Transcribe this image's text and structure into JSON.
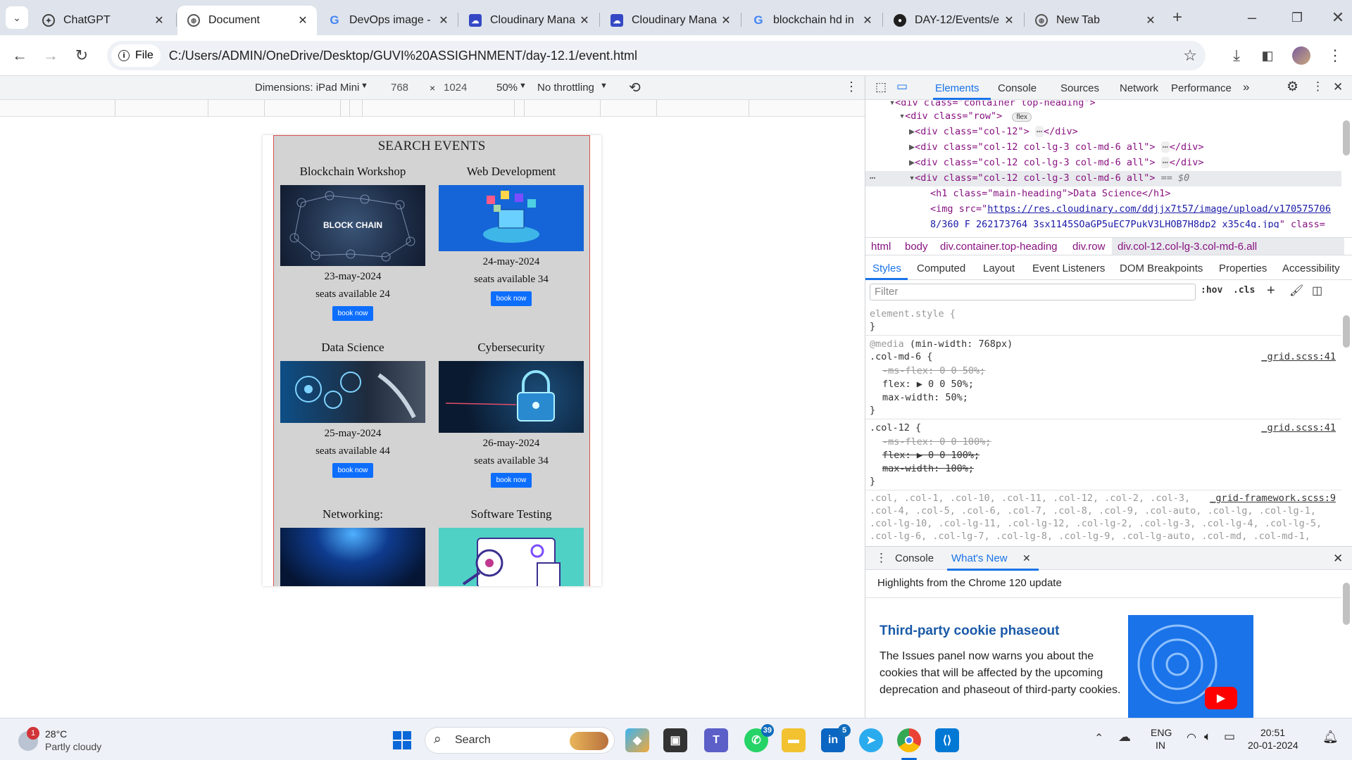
{
  "tabs": [
    {
      "title": "ChatGPT",
      "favicon": "chatgpt-icon"
    },
    {
      "title": "Document",
      "favicon": "globe-icon"
    },
    {
      "title": "DevOps image -",
      "favicon": "google-icon"
    },
    {
      "title": "Cloudinary Mana",
      "favicon": "cloudinary-icon"
    },
    {
      "title": "Cloudinary Mana",
      "favicon": "cloudinary-icon"
    },
    {
      "title": "blockchain hd in",
      "favicon": "google-icon"
    },
    {
      "title": "DAY-12/Events/e",
      "favicon": "github-icon"
    },
    {
      "title": "New Tab",
      "favicon": "globe-icon"
    }
  ],
  "active_tab": 1,
  "address": {
    "chip": "File",
    "url": "C:/Users/ADMIN/OneDrive/Desktop/GUVI%20ASSIGHNMENT/day-12.1/event.html"
  },
  "device_toolbar": {
    "dimensions": "Dimensions: iPad Mini",
    "width": "768",
    "height": "1024",
    "zoom": "50%",
    "throttle": "No throttling"
  },
  "page": {
    "heading": "SEARCH EVENTS",
    "events": [
      {
        "title": "Blockchain Workshop",
        "date": "23-may-2024",
        "seats": "seats available 24",
        "button": "book now",
        "image": "blockchain-image",
        "image_text": "BLOCK CHAIN"
      },
      {
        "title": "Web Development",
        "date": "24-may-2024",
        "seats": "seats available 34",
        "button": "book now",
        "image": "web-development-image"
      },
      {
        "title": "Data Science",
        "date": "25-may-2024",
        "seats": "seats available 44",
        "button": "book now",
        "image": "data-science-image"
      },
      {
        "title": "Cybersecurity",
        "date": "26-may-2024",
        "seats": "seats available 34",
        "button": "book now",
        "image": "cybersecurity-image"
      },
      {
        "title": "Networking:",
        "image": "networking-image"
      },
      {
        "title": "Software Testing",
        "image": "software-testing-image"
      }
    ]
  },
  "devtools": {
    "tabs": [
      "Elements",
      "Console",
      "Sources",
      "Network",
      "Performance"
    ],
    "active": "Elements",
    "dom_lines": [
      "<div class=\"container top-heading\">",
      "<div class=\"row\">",
      "<div class=\"col-12\">",
      "<div class=\"col-12 col-lg-3 col-md-6 all\">",
      "<div class=\"col-12 col-lg-3 col-md-6 all\">",
      "<div class=\"col-12 col-lg-3 col-md-6 all\">",
      "<h1 class=\"main-heading\">Data Science</h1>",
      "<img src=\"",
      "https://res.cloudinary.com/ddjjx7t57/image/upload/v170575706",
      "8/360_F_262173764_3sx1145SOaGP5uEC7PukV3LHOB7H8dp2_x35c4g.jpg",
      "\" class="
    ],
    "flex_badge": "flex",
    "selected_suffix": "== $0",
    "breadcrumbs": [
      "html",
      "body",
      "div.container.top-heading",
      "div.row",
      "div.col-12.col-lg-3.col-md-6.all"
    ],
    "style_tabs": [
      "Styles",
      "Computed",
      "Layout",
      "Event Listeners",
      "DOM Breakpoints",
      "Properties",
      "Accessibility"
    ],
    "filter_placeholder": "Filter",
    "filter_tools": [
      ":hov",
      ".cls"
    ],
    "rules": {
      "element_style": "element.style {",
      "media": "@media",
      "media_query": "(min-width: 768px)",
      "md6_selector": ".col-md-6 {",
      "md6_source": "_grid.scss:41",
      "md6_props": [
        "-ms-flex: 0 0 50%;",
        "flex: ▶ 0 0 50%;",
        "max-width: 50%;"
      ],
      "c12_selector": ".col-12 {",
      "c12_source": "_grid.scss:41",
      "c12_props": [
        "-ms-flex: 0 0 100%;",
        "flex: ▶ 0 0 100%;",
        "max-width: 100%;"
      ],
      "framework_line1": ".col, .col-1, .col-10, .col-11, .col-12, .col-2, .col-3,",
      "framework_source": "_grid-framework.scss:9",
      "framework_line2": ".col-4, .col-5, .col-6, .col-7, .col-8, .col-9, .col-auto, .col-lg, .col-lg-1,",
      "framework_line3": ".col-lg-10, .col-lg-11, .col-lg-12, .col-lg-2, .col-lg-3, .col-lg-4, .col-lg-5,",
      "framework_line4": ".col-lg-6, .col-lg-7, .col-lg-8, .col-lg-9, .col-lg-auto, .col-md, .col-md-1,",
      "close_brace": "}"
    },
    "drawer_tabs": [
      "Console",
      "What's New"
    ],
    "whats_new": {
      "highlight": "Highlights from the Chrome 120 update",
      "title": "Third-party cookie phaseout",
      "body": "The Issues panel now warns you about the cookies that will be affected by the upcoming deprecation and phaseout of third-party cookies."
    }
  },
  "taskbar": {
    "weather_temp": "28°C",
    "weather_desc": "Partly cloudy",
    "weather_badge": "1",
    "search": "Search",
    "whatsapp_badge": "39",
    "linkedin_badge": "5",
    "lang": "ENG",
    "region": "IN",
    "time": "20:51",
    "date": "20-01-2024"
  },
  "colors": {
    "accent": "#1a73e8",
    "book_button": "#0d6efd",
    "panel_border": "#d9534f"
  }
}
